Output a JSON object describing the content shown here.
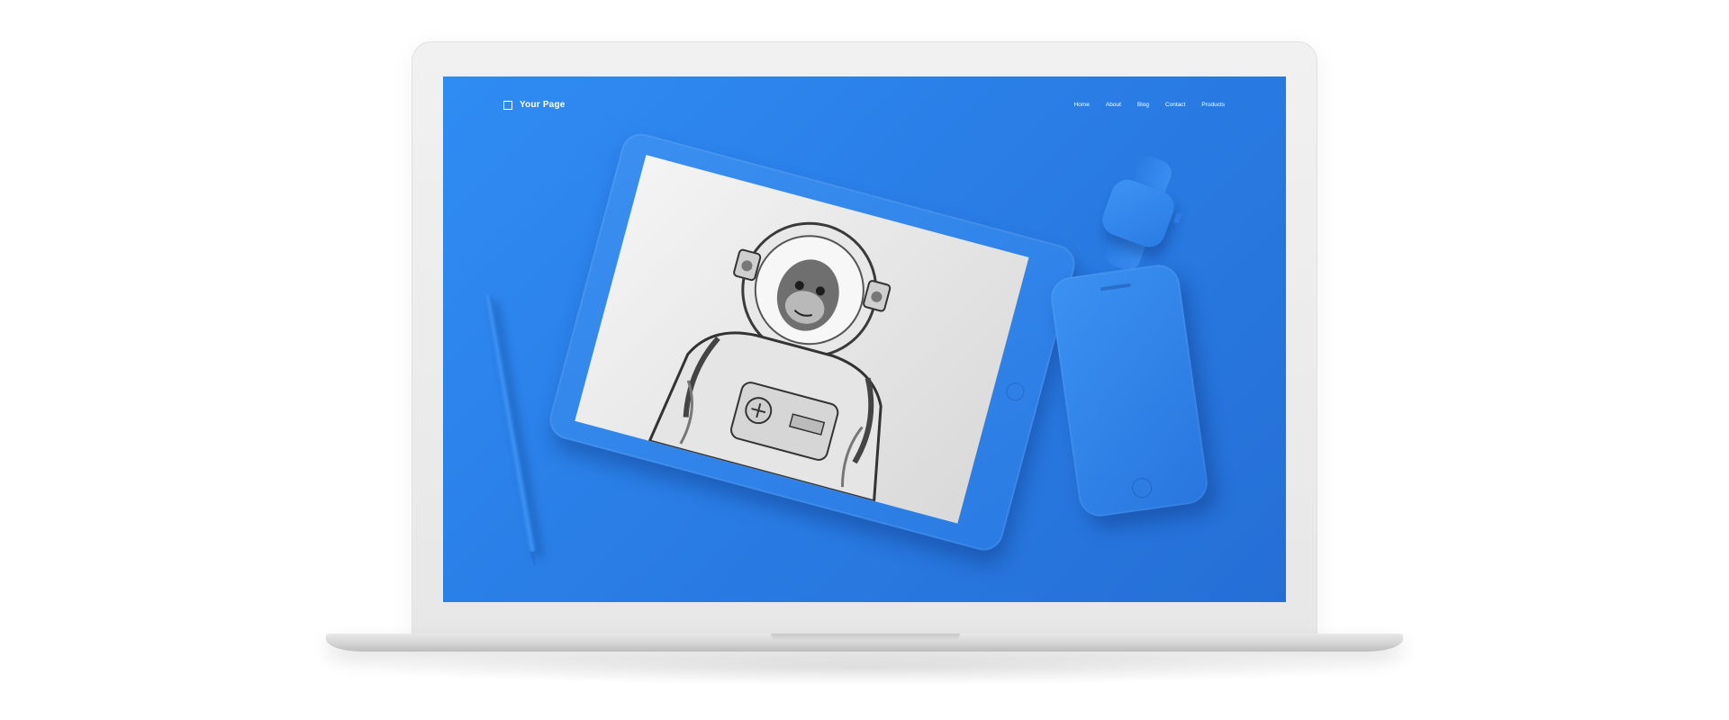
{
  "page": {
    "brand": {
      "icon": "square-outline-icon",
      "name": "Your Page"
    },
    "nav": {
      "items": [
        {
          "label": "Home"
        },
        {
          "label": "About"
        },
        {
          "label": "Blog"
        },
        {
          "label": "Contact"
        },
        {
          "label": "Products"
        }
      ]
    }
  },
  "colors": {
    "screen_background": "#2a7ee6",
    "nav_text": "#ffffff",
    "device_blue": "#2f86ec",
    "laptop_frame": "#ececec"
  },
  "scene": {
    "devices": [
      "tablet",
      "stylus-pencil",
      "smartwatch",
      "smartphone"
    ],
    "tablet_artwork": "monkey-astronaut-sketch"
  }
}
